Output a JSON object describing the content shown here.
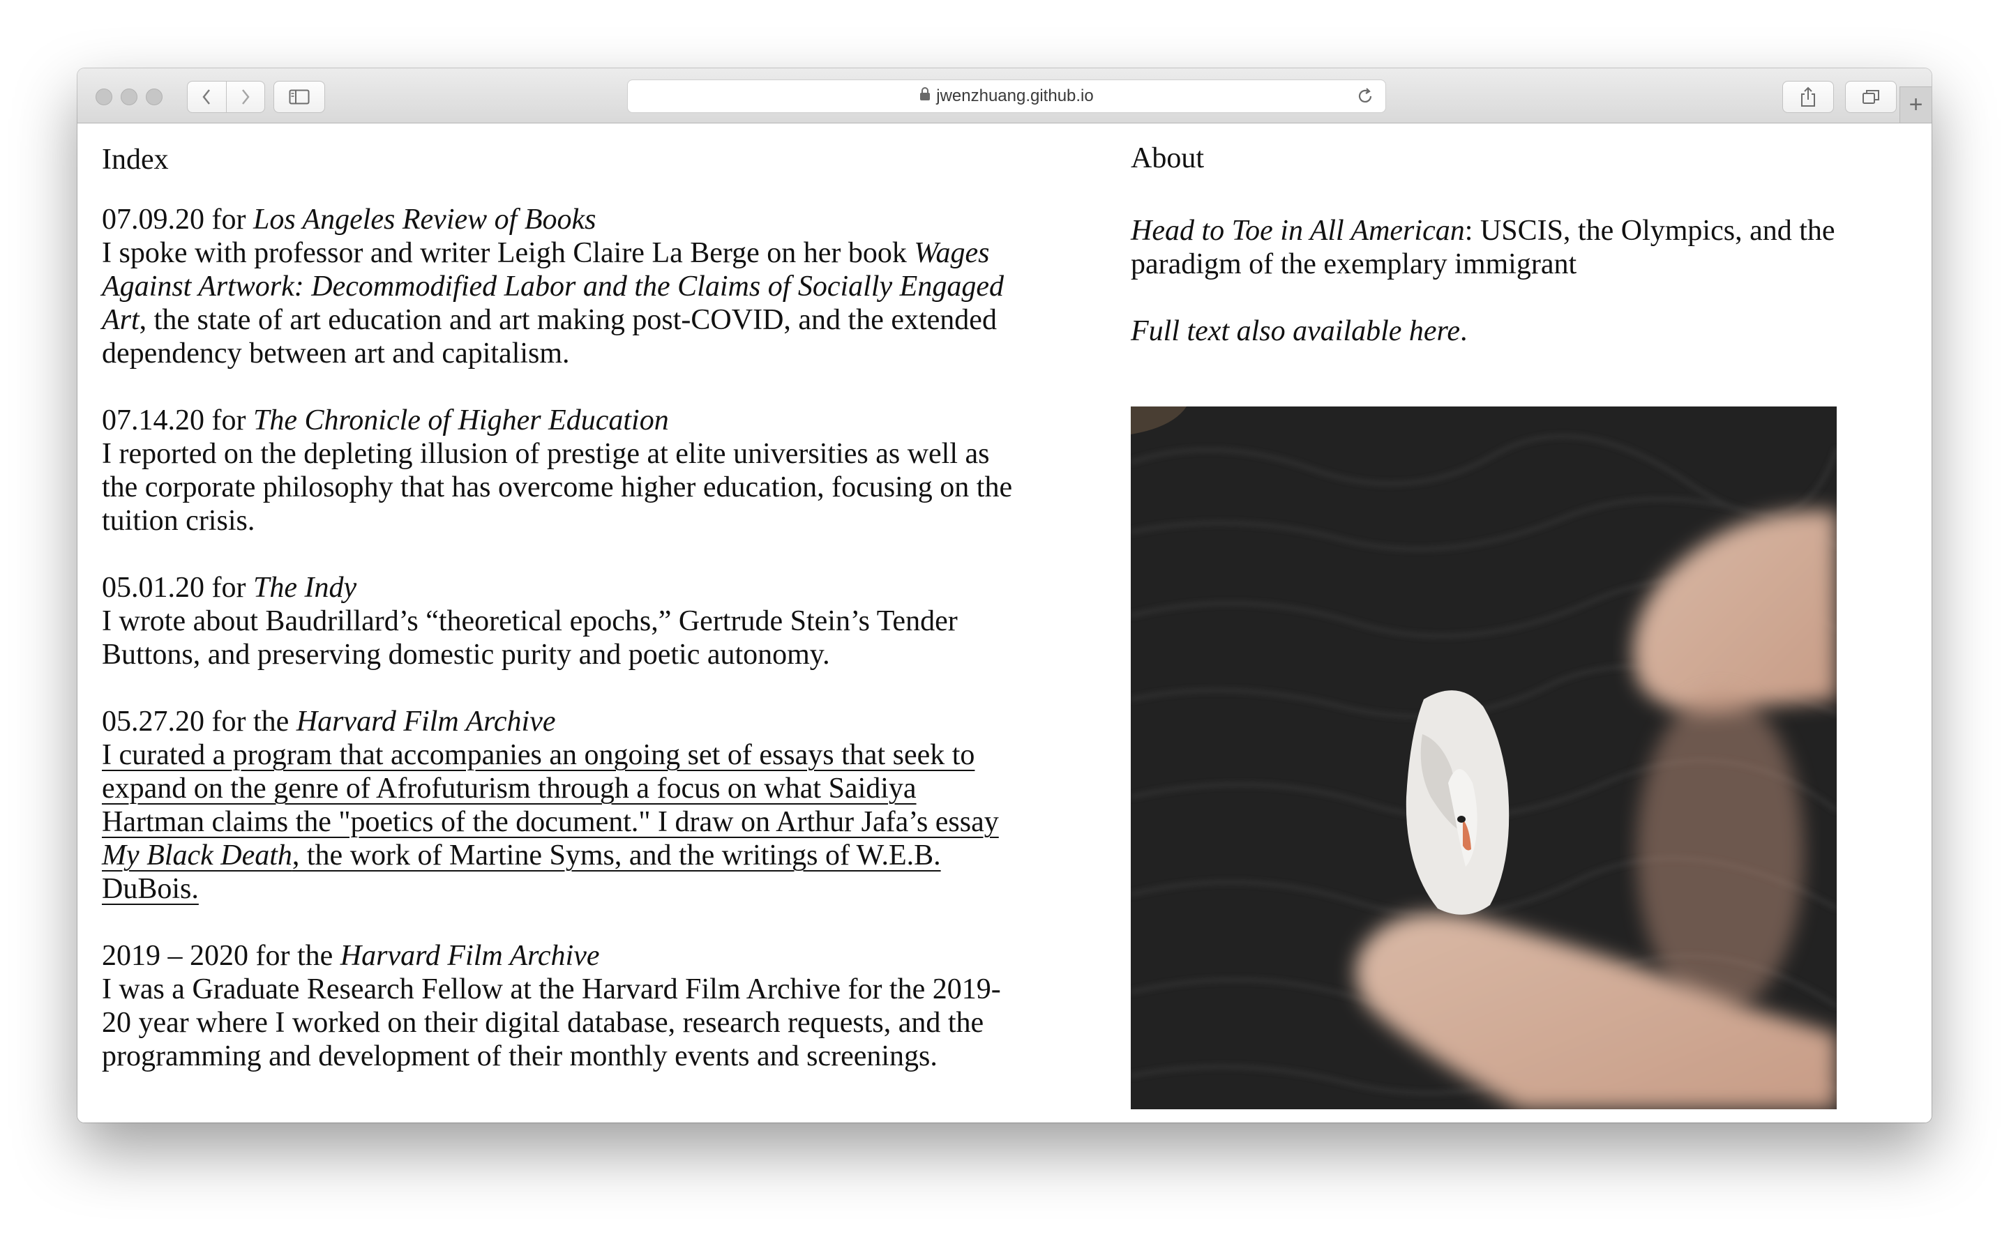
{
  "browser": {
    "url": "jwenzhuang.github.io",
    "new_tab_symbol": "+"
  },
  "left_column": {
    "heading": "Index",
    "entries": [
      {
        "date_prefix": "07.09.20 for ",
        "publication": "Los Angeles Review of Books",
        "body_1": "I spoke with professor and writer Leigh Claire La Berge on her book ",
        "body_italic": "Wages Against Artwork: Decommodified Labor and the Claims of Socially Engaged Art",
        "body_2": ", the state of art education and art making post-COVID, and the extended dependency between art and capitalism."
      },
      {
        "date_prefix": "07.14.20 for ",
        "publication": "The Chronicle of Higher Education",
        "body_1": "I reported on the depleting illusion of prestige at elite universities as well as the corporate philosophy that has overcome higher education, focusing on the tuition crisis."
      },
      {
        "date_prefix": "05.01.20 for ",
        "publication": "The Indy",
        "body_1": "I wrote about Baudrillard’s “theoretical epochs,” Gertrude Stein’s Tender Buttons, and preserving domestic purity and poetic autonomy."
      },
      {
        "date_prefix": "05.27.20 for the ",
        "publication": "Harvard Film Archive",
        "body_1": "I curated a program that accompanies an ongoing set of essays that seek to expand on the genre of Afrofuturism through a focus on what Saidiya Hartman claims the \"poetics of the document.\" I draw on Arthur Jafa’s essay ",
        "body_italic": "My Black Death",
        "body_2": ", the work of Martine Syms, and the writings of W.E.B. DuBois."
      },
      {
        "date_prefix": "2019 – 2020 for the ",
        "publication": "Harvard Film Archive",
        "body_1": "I was a Graduate Research Fellow at the Harvard Film Archive for the 2019-20 year where I worked on their digital database, research requests, and the programming and development of their monthly events and screenings."
      }
    ]
  },
  "right_column": {
    "heading": "About",
    "article_title": "Head to Toe in All American",
    "article_subtitle": ": USCIS, the Olympics, and the paradigm of the exemplary immigrant",
    "full_text_link": "Full text also available here",
    "full_text_period": ".",
    "image_alt": "white swan on dark water pinched between two fingers"
  },
  "colors": {
    "page_bg": "#ffffff",
    "text": "#111111",
    "toolbar": "#e4e4e4"
  }
}
